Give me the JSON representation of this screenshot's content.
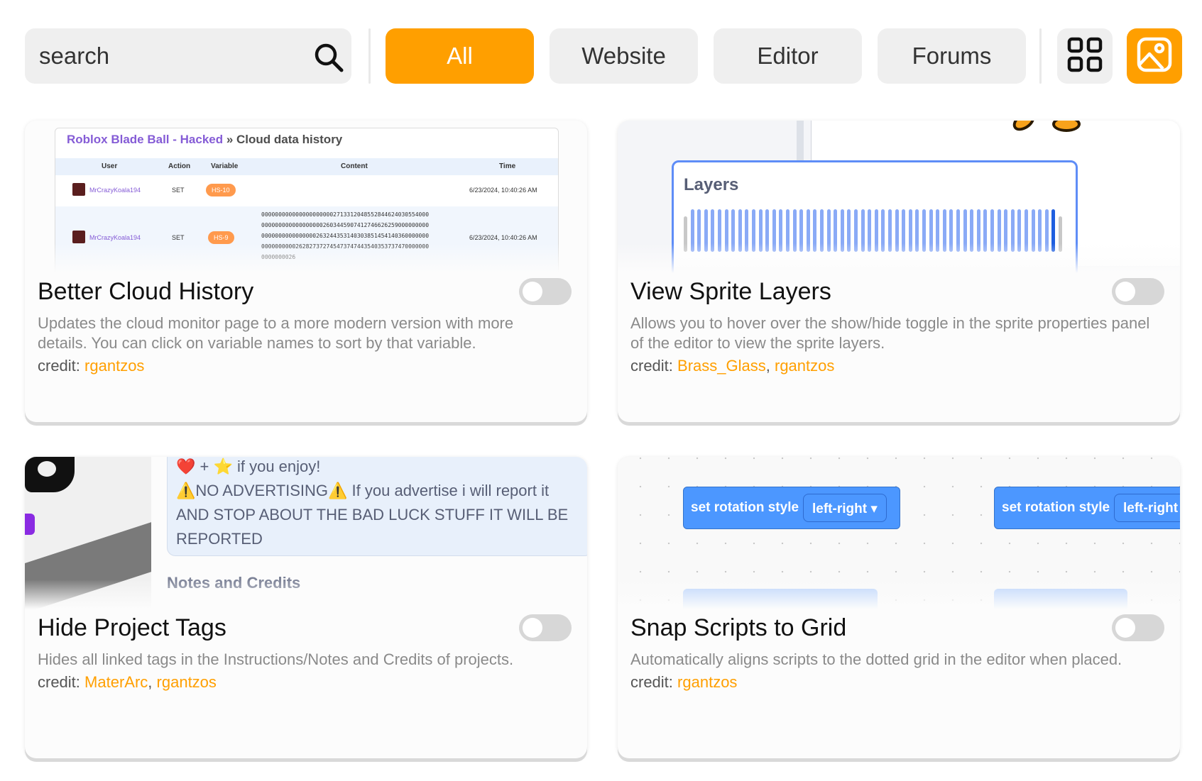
{
  "search": {
    "placeholder": "search"
  },
  "filters": [
    {
      "label": "All",
      "active": true
    },
    {
      "label": "Website",
      "active": false
    },
    {
      "label": "Editor",
      "active": false
    },
    {
      "label": "Forums",
      "active": false
    }
  ],
  "view_buttons": {
    "grid_icon": "grid-icon",
    "image_icon": "image-icon"
  },
  "accent_color": "#ff9f00",
  "credit_label": "credit:",
  "cards": [
    {
      "title": "Better Cloud History",
      "description": "Updates the cloud monitor page to a more modern version with more details. You can click on variable names to sort by that variable.",
      "credits": [
        "rgantzos"
      ],
      "enabled": false,
      "preview": {
        "breadcrumb_project": "Roblox Blade Ball - Hacked",
        "breadcrumb_sep": " » ",
        "breadcrumb_page": "Cloud data history",
        "columns": [
          "User",
          "Action",
          "Variable",
          "Content",
          "Time"
        ],
        "rows": [
          {
            "user": "MrCrazyKoala194",
            "action": "SET",
            "variable": "HS-10",
            "content": [],
            "time": "6/23/2024, 10:40:26 AM"
          },
          {
            "user": "MrCrazyKoala194",
            "action": "SET",
            "variable": "HS-9",
            "content": [
              "000000000000000000000271331204855284462403055400​0",
              "000000000000000000260344590741274662625900000000​0",
              "000000000000000026324435314030385145414036000000​0",
              "000000000026282737274547374744354035373747000000​0",
              "0000000026"
            ],
            "time": "6/23/2024, 10:40:26 AM"
          }
        ]
      }
    },
    {
      "title": "View Sprite Layers",
      "description": "Allows you to hover over the show/hide toggle in the sprite properties panel of the editor to view the sprite layers.",
      "credits": [
        "Brass_Glass",
        "rgantzos"
      ],
      "enabled": false,
      "preview": {
        "panel_label": "Layers"
      }
    },
    {
      "title": "Hide Project Tags",
      "description": "Hides all linked tags in the Instructions/Notes and Credits of projects.",
      "credits": [
        "MaterArc",
        "rgantzos"
      ],
      "enabled": false,
      "preview": {
        "lines": [
          "❤️ + ⭐ if you enjoy!",
          "⚠️NO ADVERTISING⚠️ If you advertise i will report it",
          "AND STOP ABOUT THE BAD LUCK STUFF IT WILL BE",
          "REPORTED"
        ],
        "notes_heading": "Notes and Credits"
      }
    },
    {
      "title": "Snap Scripts to Grid",
      "description": "Automatically aligns scripts to the dotted grid in the editor when placed.",
      "credits": [
        "rgantzos"
      ],
      "enabled": false,
      "preview": {
        "block_label": "set rotation style",
        "dropdown_value": "left-right",
        "dropdown_arrow": "▾"
      }
    }
  ]
}
